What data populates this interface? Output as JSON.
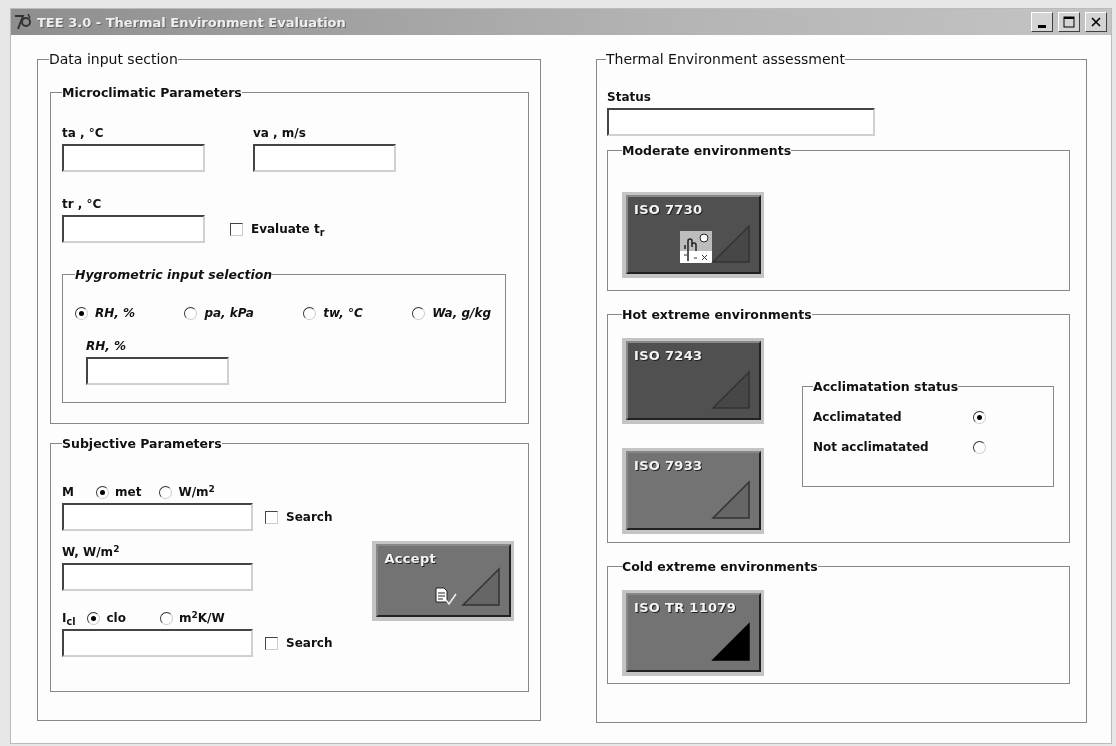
{
  "window": {
    "title": "TEE 3.0 - Thermal Environment Evaluation"
  },
  "data_input": {
    "title": "Data input section",
    "microclimatic": {
      "title": "Microclimatic Parameters",
      "fields": [
        {
          "label": "ta , °C"
        },
        {
          "label": "va , m/s"
        },
        {
          "label": "tr , °C"
        }
      ],
      "evaluate": {
        "label": "Evaluate t$_{r}$",
        "checked": false
      },
      "hygrometric": {
        "title": "Hygrometric input selection",
        "options": [
          {
            "label": "RH, %",
            "selected": true
          },
          {
            "label": "pa, kPa",
            "selected": false
          },
          {
            "label": "tw, °C",
            "selected": false
          },
          {
            "label": "Wa, g/kg",
            "selected": false
          }
        ],
        "field_label": "RH, %"
      }
    },
    "subjective": {
      "title": "Subjective Parameters",
      "metabolic": {
        "label": "M",
        "options": [
          {
            "label": "met",
            "selected": true
          },
          {
            "label": "W/m$^{2}$",
            "selected": false
          }
        ],
        "search": {
          "label": "Search",
          "checked": false
        }
      },
      "work": {
        "label": "W, W/m$^{2}$"
      },
      "clothing": {
        "label": "I$_{cl}$",
        "options": [
          {
            "label": "clo",
            "selected": true
          },
          {
            "label": "m$^{2}$K/W",
            "selected": false
          }
        ],
        "search": {
          "label": "Search",
          "checked": false
        }
      },
      "accept": {
        "label": "Accept"
      }
    }
  },
  "assessment": {
    "title": "Thermal Environment assessment",
    "status_label": "Status",
    "groups": [
      {
        "title": "Moderate environments",
        "buttons": [
          {
            "label": "ISO 7730",
            "dark": true,
            "flagged": false,
            "icon": true
          }
        ]
      },
      {
        "title": "Hot extreme environments",
        "buttons": [
          {
            "label": "ISO 7243",
            "dark": true,
            "flagged": false,
            "icon": false
          },
          {
            "label": "ISO 7933",
            "dark": false,
            "flagged": false,
            "icon": false
          }
        ],
        "acclimatation": {
          "title": "Acclimatation status",
          "options": [
            {
              "label": "Acclimatated",
              "selected": true
            },
            {
              "label": "Not acclimatated",
              "selected": false
            }
          ]
        }
      },
      {
        "title": "Cold extreme environments",
        "buttons": [
          {
            "label": "ISO TR 11079",
            "dark": false,
            "flagged": true,
            "icon": false
          }
        ]
      }
    ]
  }
}
